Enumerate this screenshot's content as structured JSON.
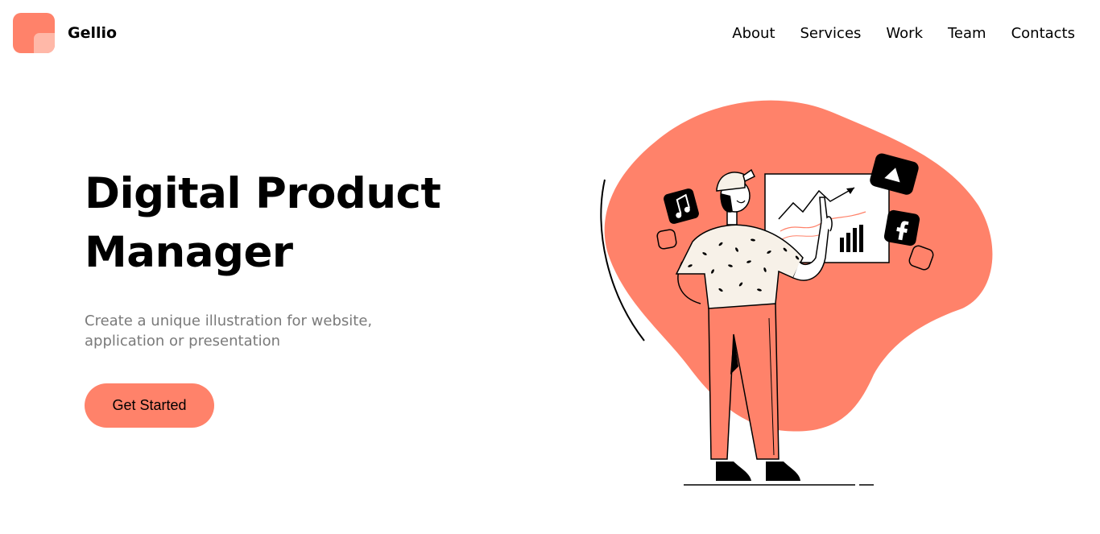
{
  "header": {
    "brand": "Gellio",
    "nav": [
      "About",
      "Services",
      "Work",
      "Team",
      "Contacts"
    ]
  },
  "hero": {
    "title_line1": "Digital Product",
    "title_line2": "Manager",
    "subtitle_line1": "Create a unique illustration for website,",
    "subtitle_line2": "application or presentation",
    "cta_label": "Get Started"
  },
  "colors": {
    "accent": "#FF826A",
    "accent_light": "#FFB8A8",
    "text_muted": "#7a7a7a"
  },
  "illustration": {
    "icons": [
      "music-note-icon",
      "play-icon",
      "facebook-icon",
      "line-chart-icon",
      "bar-chart-icon"
    ]
  }
}
